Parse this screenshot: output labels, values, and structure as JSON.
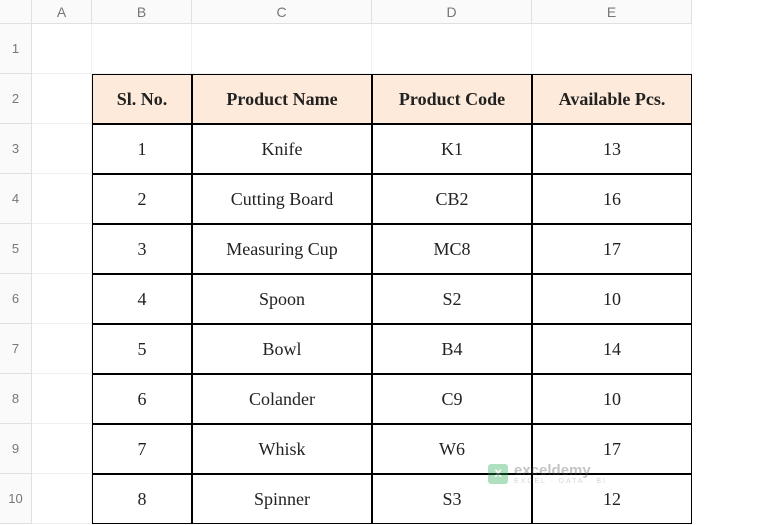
{
  "columns": [
    "A",
    "B",
    "C",
    "D",
    "E"
  ],
  "rows": [
    "1",
    "2",
    "3",
    "4",
    "5",
    "6",
    "7",
    "8",
    "9",
    "10"
  ],
  "table": {
    "headers": [
      "Sl. No.",
      "Product Name",
      "Product Code",
      "Available Pcs."
    ],
    "data": [
      {
        "sl": "1",
        "name": "Knife",
        "code": "K1",
        "pcs": "13"
      },
      {
        "sl": "2",
        "name": "Cutting Board",
        "code": "CB2",
        "pcs": "16"
      },
      {
        "sl": "3",
        "name": "Measuring Cup",
        "code": "MC8",
        "pcs": "17"
      },
      {
        "sl": "4",
        "name": "Spoon",
        "code": "S2",
        "pcs": "10"
      },
      {
        "sl": "5",
        "name": "Bowl",
        "code": "B4",
        "pcs": "14"
      },
      {
        "sl": "6",
        "name": "Colander",
        "code": "C9",
        "pcs": "10"
      },
      {
        "sl": "7",
        "name": "Whisk",
        "code": "W6",
        "pcs": "17"
      },
      {
        "sl": "8",
        "name": "Spinner",
        "code": "S3",
        "pcs": "12"
      }
    ]
  },
  "watermark": {
    "title": "exceldemy",
    "subtitle": "EXCEL · DATA · BI"
  }
}
